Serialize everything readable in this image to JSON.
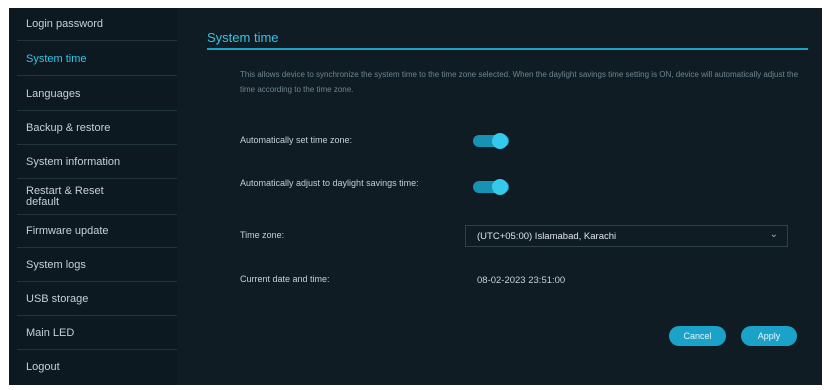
{
  "sidebar": {
    "items": [
      {
        "label": "Login password"
      },
      {
        "label": "System time"
      },
      {
        "label": "Languages"
      },
      {
        "label": "Backup & restore"
      },
      {
        "label": "System information"
      },
      {
        "label": "Restart & Reset\ndefault"
      },
      {
        "label": "Firmware update"
      },
      {
        "label": "System logs"
      },
      {
        "label": "USB storage"
      },
      {
        "label": "Main LED"
      },
      {
        "label": "Logout"
      }
    ],
    "active_index": 1
  },
  "main": {
    "title": "System time",
    "description": "This allows device to synchronize the system time to the time zone selected. When the daylight savings time setting is ON, device will automatically adjust the time according to the time zone.",
    "auto_timezone": {
      "label": "Automatically set time zone:",
      "enabled": true
    },
    "auto_dst": {
      "label": "Automatically adjust to daylight savings time:",
      "enabled": true
    },
    "time_zone": {
      "label": "Time zone:",
      "value": "(UTC+05:00) Islamabad, Karachi"
    },
    "current_datetime": {
      "label": "Current date and time:",
      "value": "08-02-2023 23:51:00"
    },
    "buttons": {
      "cancel": "Cancel",
      "apply": "Apply"
    }
  },
  "colors": {
    "accent": "#33c4e6",
    "background": "#0f1c24",
    "button": "#1aa2c8"
  },
  "icons": {
    "dropdown": "chevron-down-icon"
  }
}
